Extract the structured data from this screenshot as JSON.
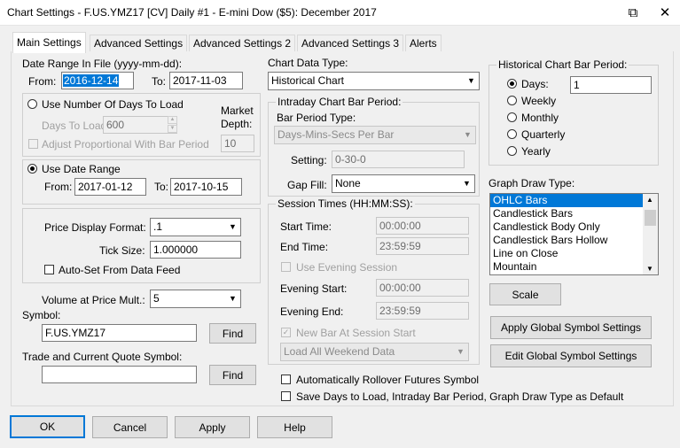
{
  "window": {
    "title": "Chart Settings - F.US.YMZ17 [CV]  Daily  #1 - E-mini Dow ($5): December 2017",
    "restore_glyph": "⧉",
    "close_glyph": "✕"
  },
  "tabs": [
    {
      "label": "Main Settings"
    },
    {
      "label": "Advanced Settings"
    },
    {
      "label": "Advanced Settings 2"
    },
    {
      "label": "Advanced Settings 3"
    },
    {
      "label": "Alerts"
    }
  ],
  "date_range_file": {
    "label": "Date Range In File (yyyy-mm-dd):",
    "from_label": "From:",
    "from_value": "2016-12-14",
    "to_label": "To:",
    "to_value": "2017-11-03"
  },
  "days_group": {
    "radio_label": "Use Number Of Days To Load",
    "days_to_load_label": "Days To Load:",
    "days_to_load_value": "600",
    "adjust_label": "Adjust Proportional With Bar Period",
    "market_depth_label_1": "Market",
    "market_depth_label_2": "Depth:",
    "market_depth_value": "10"
  },
  "date_range_group": {
    "radio_label": "Use Date Range",
    "from_label": "From:",
    "from_value": "2017-01-12",
    "to_label": "To:",
    "to_value": "2017-10-15"
  },
  "price_group": {
    "format_label": "Price Display Format:",
    "format_value": ".1",
    "tick_label": "Tick Size:",
    "tick_value": "1.000000",
    "autoset_label": "Auto-Set From Data Feed"
  },
  "volume": {
    "label": "Volume at Price Mult.:",
    "value": "5"
  },
  "symbol": {
    "label": "Symbol:",
    "value": "F.US.YMZ17",
    "find_label": "Find"
  },
  "trade_symbol": {
    "label": "Trade and Current Quote Symbol:",
    "value": "",
    "find_label": "Find"
  },
  "chart_data_type": {
    "label": "Chart Data Type:",
    "value": "Historical Chart"
  },
  "intraday": {
    "title": "Intraday Chart Bar Period:",
    "bar_period_type_label": "Bar Period Type:",
    "bar_period_type_value": "Days-Mins-Secs Per Bar",
    "setting_label": "Setting:",
    "setting_value": "0-30-0",
    "gap_fill_label": "Gap Fill:",
    "gap_fill_value": "None"
  },
  "session": {
    "title": "Session Times (HH:MM:SS):",
    "start_label": "Start Time:",
    "start_value": "00:00:00",
    "end_label": "End Time:",
    "end_value": "23:59:59",
    "use_evening_label": "Use Evening Session",
    "evening_start_label": "Evening Start:",
    "evening_start_value": "00:00:00",
    "evening_end_label": "Evening End:",
    "evening_end_value": "23:59:59",
    "new_bar_label": "New Bar At Session Start",
    "weekend_value": "Load All Weekend Data"
  },
  "options": {
    "auto_rollover_label": "Automatically Rollover Futures Symbol",
    "save_default_label": "Save Days to Load, Intraday Bar Period, Graph Draw Type as Default"
  },
  "historical_period": {
    "title": "Historical Chart Bar Period:",
    "options": [
      {
        "label": "Days:",
        "selected": true
      },
      {
        "label": "Weekly",
        "selected": false
      },
      {
        "label": "Monthly",
        "selected": false
      },
      {
        "label": "Quarterly",
        "selected": false
      },
      {
        "label": "Yearly",
        "selected": false
      }
    ],
    "days_value": "1"
  },
  "graph_draw": {
    "label": "Graph Draw Type:",
    "items": [
      "OHLC Bars",
      "Candlestick Bars",
      "Candlestick Body Only",
      "Candlestick Bars Hollow",
      "Line on Close",
      "Mountain"
    ],
    "selected_index": 0
  },
  "buttons_right": {
    "scale": "Scale",
    "apply_global": "Apply Global Symbol Settings",
    "edit_global": "Edit Global Symbol Settings"
  },
  "footer": {
    "ok": "OK",
    "cancel": "Cancel",
    "apply": "Apply",
    "help": "Help"
  },
  "colors": {
    "accent": "#0078d7"
  }
}
